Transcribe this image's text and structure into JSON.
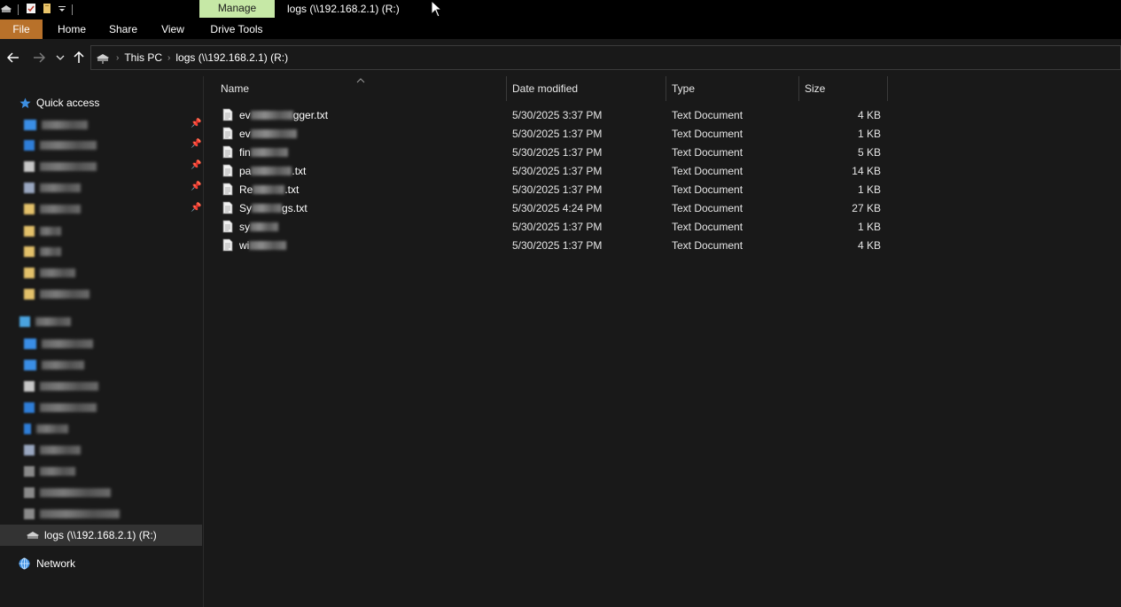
{
  "titlebar": {
    "manage_tab": "Manage",
    "window_title": "logs (\\\\192.168.2.1) (R:)"
  },
  "ribbon": {
    "tabs": [
      "File",
      "Home",
      "Share",
      "View",
      "Drive Tools"
    ]
  },
  "address_bar": {
    "crumbs": [
      "This PC",
      "logs (\\\\192.168.2.1) (R:)"
    ]
  },
  "sidebar": {
    "quick_access": "Quick access",
    "current_drive": "logs (\\\\192.168.2.1) (R:)",
    "network": "Network"
  },
  "columns": {
    "name": "Name",
    "date": "Date modified",
    "type": "Type",
    "size": "Size"
  },
  "files": [
    {
      "prefix": "ev",
      "suffix": "gger.txt",
      "date": "5/30/2025 3:37 PM",
      "type": "Text Document",
      "size": "4 KB"
    },
    {
      "prefix": "ev",
      "suffix": "",
      "date": "5/30/2025 1:37 PM",
      "type": "Text Document",
      "size": "1 KB"
    },
    {
      "prefix": "fin",
      "suffix": "",
      "date": "5/30/2025 1:37 PM",
      "type": "Text Document",
      "size": "5 KB"
    },
    {
      "prefix": "pa",
      "suffix": ".txt",
      "date": "5/30/2025 1:37 PM",
      "type": "Text Document",
      "size": "14 KB"
    },
    {
      "prefix": "Re",
      "suffix": ".txt",
      "date": "5/30/2025 1:37 PM",
      "type": "Text Document",
      "size": "1 KB"
    },
    {
      "prefix": "Sy",
      "suffix": "gs.txt",
      "date": "5/30/2025 4:24 PM",
      "type": "Text Document",
      "size": "27 KB"
    },
    {
      "prefix": "sy",
      "suffix": "",
      "date": "5/30/2025 1:37 PM",
      "type": "Text Document",
      "size": "1 KB"
    },
    {
      "prefix": "wi",
      "suffix": "",
      "date": "5/30/2025 1:37 PM",
      "type": "Text Document",
      "size": "4 KB"
    }
  ],
  "colors": {
    "background": "#191919",
    "file_tab": "#b8712a",
    "manage_tab": "#c6e8a6",
    "selection": "#333333"
  }
}
